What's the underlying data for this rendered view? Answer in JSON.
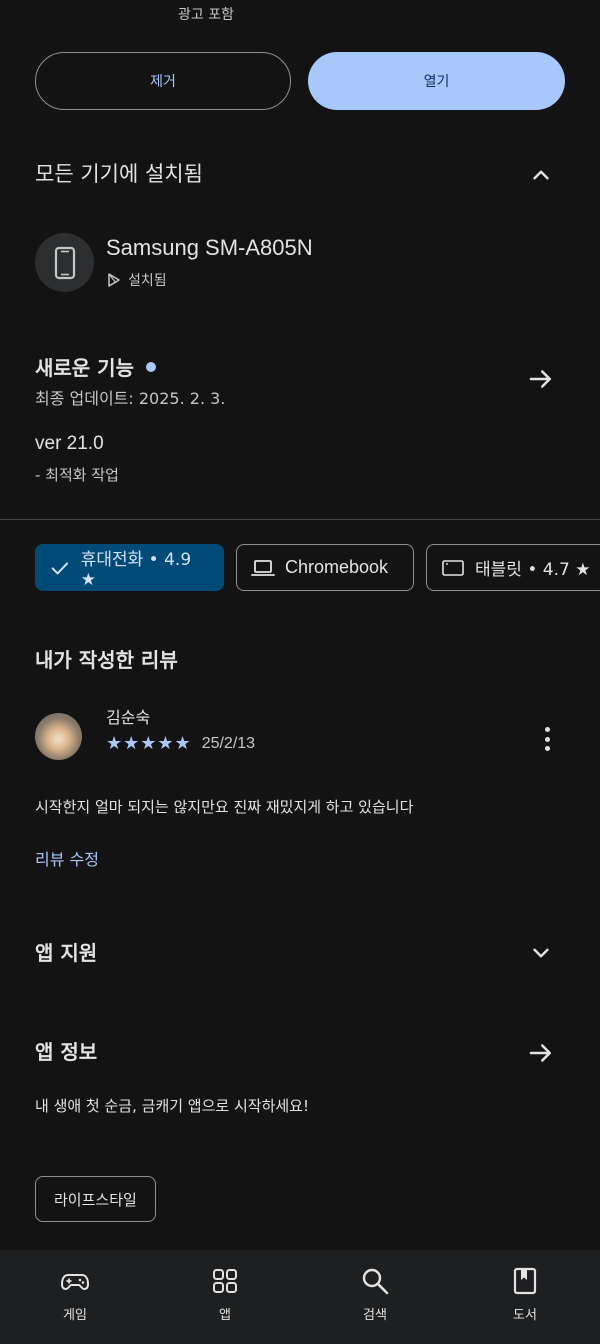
{
  "header": {
    "ads_note": "광고 포함"
  },
  "actions": {
    "remove_label": "제거",
    "open_label": "열기"
  },
  "installed": {
    "title": "모든 기기에 설치됨",
    "device_name": "Samsung SM-A805N",
    "device_status": "설치됨"
  },
  "whats_new": {
    "title": "새로운 기능",
    "updated": "최종 업데이트: 2025. 2. 3.",
    "version": "ver 21.0",
    "note": "- 최적화 작업"
  },
  "device_chips": [
    {
      "label": "휴대전화 • 4.9 ★",
      "selected": true
    },
    {
      "label": "Chromebook",
      "selected": false
    },
    {
      "label": "태블릿 • 4.7 ★",
      "selected": false
    }
  ],
  "my_review": {
    "title": "내가 작성한 리뷰",
    "reviewer": "김순숙",
    "stars": "★★★★★",
    "rating": 5,
    "date": "25/2/13",
    "text": "시작한지 얼마 되지는 않지만요 진짜 재밌지게 하고 있습니다",
    "edit_label": "리뷰 수정"
  },
  "app_support": {
    "title": "앱 지원"
  },
  "app_info": {
    "title": "앱 정보",
    "description": "내 생애 첫 순금, 금캐기 앱으로 시작하세요!",
    "tag": "라이프스타일"
  },
  "bottom_nav": [
    {
      "label": "게임",
      "icon": "gamepad-icon"
    },
    {
      "label": "앱",
      "icon": "apps-grid-icon"
    },
    {
      "label": "검색",
      "icon": "search-icon"
    },
    {
      "label": "도서",
      "icon": "book-icon"
    }
  ],
  "colors": {
    "background": "#131314",
    "accent": "#a8c7fa",
    "selected_chip": "#004a77",
    "nav_bg": "#1e1f20"
  }
}
